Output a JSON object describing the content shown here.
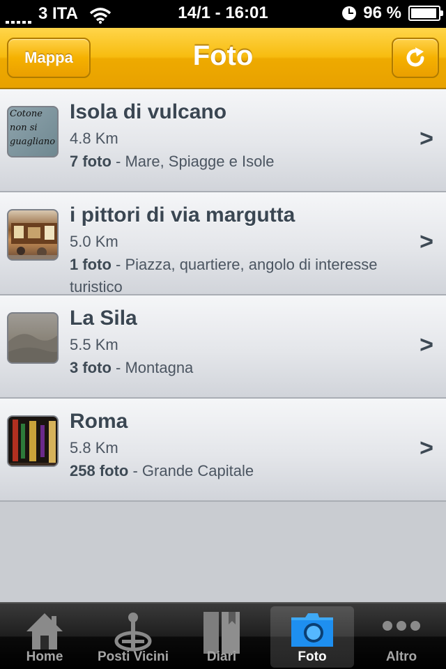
{
  "status_bar": {
    "carrier": "3 ITA",
    "datetime": "14/1 - 16:01",
    "battery": "96 %",
    "battery_level": 0.96
  },
  "nav": {
    "title": "Foto",
    "left_button": "Mappa",
    "right_button_icon": "refresh-icon"
  },
  "list": {
    "items": [
      {
        "title": "Isola di vulcano",
        "distance": "4.8 Km",
        "count": "7 foto",
        "category": " - Mare, Spiagge e Isole",
        "thumb_text": [
          "Cotone",
          "non si",
          "guagliano"
        ]
      },
      {
        "title": "i pittori di via margutta",
        "distance": "5.0 Km",
        "count": "1 foto",
        "category": " - Piazza, quartiere, angolo di interesse turistico"
      },
      {
        "title": "La Sila",
        "distance": "5.5 Km",
        "count": "3 foto",
        "category": " - Montagna"
      },
      {
        "title": "Roma",
        "distance": "5.8 Km",
        "count": "258 foto",
        "category": " - Grande Capitale"
      }
    ],
    "chevron": ">"
  },
  "tabbar": {
    "tabs": [
      {
        "label": "Home",
        "icon": "home-icon"
      },
      {
        "label": "Posti Vicini",
        "icon": "joystick-icon"
      },
      {
        "label": "Diari",
        "icon": "book-icon"
      },
      {
        "label": "Foto",
        "icon": "camera-folder-icon",
        "active": true
      },
      {
        "label": "Altro",
        "icon": "more-dots-icon"
      }
    ]
  },
  "colors": {
    "nav_yellow": "#f7bc10",
    "text_dark": "#3a4652",
    "tab_active": "#ffffff",
    "tab_inactive": "#a6a6a6"
  }
}
